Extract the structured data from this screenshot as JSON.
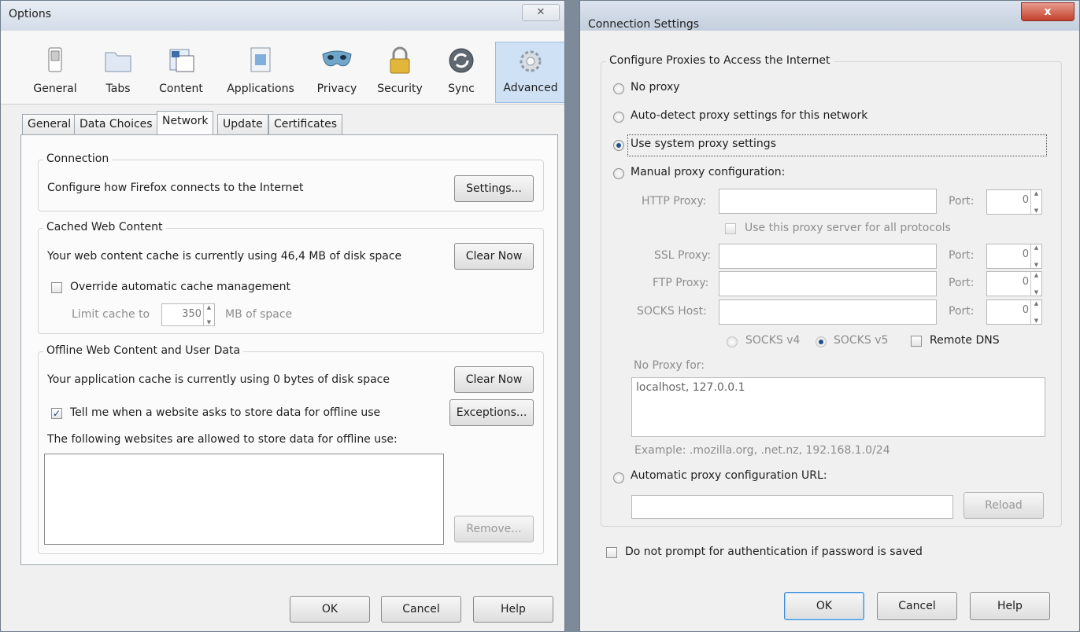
{
  "options": {
    "title": "Options",
    "categories": [
      {
        "label": "General",
        "icon": "general-switch-icon"
      },
      {
        "label": "Tabs",
        "icon": "tabs-folder-icon"
      },
      {
        "label": "Content",
        "icon": "content-icon"
      },
      {
        "label": "Applications",
        "icon": "applications-icon"
      },
      {
        "label": "Privacy",
        "icon": "privacy-mask-icon"
      },
      {
        "label": "Security",
        "icon": "security-lock-icon"
      },
      {
        "label": "Sync",
        "icon": "sync-icon"
      },
      {
        "label": "Advanced",
        "icon": "advanced-gear-icon"
      }
    ],
    "subtabs": [
      "General",
      "Data Choices",
      "Network",
      "Update",
      "Certificates"
    ],
    "connection": {
      "group_label": "Connection",
      "desc": "Configure how Firefox connects to the Internet",
      "settings_button": "Settings..."
    },
    "cache": {
      "group_label": "Cached Web Content",
      "desc": "Your web content cache is currently using 46,4 MB of disk space",
      "clear_button": "Clear Now",
      "override_label": "Override automatic cache management",
      "limit_prefix": "Limit cache to",
      "limit_value": "350",
      "limit_suffix": "MB of space"
    },
    "offline": {
      "group_label": "Offline Web Content and User Data",
      "desc": "Your application cache is currently using 0 bytes of disk space",
      "clear_button": "Clear Now",
      "tell_label": "Tell me when a website asks to store data for offline use",
      "exceptions_button": "Exceptions...",
      "allowed_label": "The following websites are allowed to store data for offline use:",
      "remove_button": "Remove..."
    },
    "buttons": {
      "ok": "OK",
      "cancel": "Cancel",
      "help": "Help"
    }
  },
  "connection_settings": {
    "title": "Connection Settings",
    "close_glyph": "x",
    "group_label": "Configure Proxies to Access the Internet",
    "no_proxy": "No proxy",
    "auto_detect": "Auto-detect proxy settings for this network",
    "use_system": "Use system proxy settings",
    "manual": "Manual proxy configuration:",
    "http_label": "HTTP Proxy:",
    "port_label": "Port:",
    "use_all": "Use this proxy server for all protocols",
    "ssl_label": "SSL Proxy:",
    "ftp_label": "FTP Proxy:",
    "socks_label": "SOCKS Host:",
    "port_value": "0",
    "socks_v4": "SOCKS v4",
    "socks_v5": "SOCKS v5",
    "remote_dns": "Remote DNS",
    "no_proxy_for": "No Proxy for:",
    "no_proxy_value": "localhost, 127.0.0.1",
    "example": "Example: .mozilla.org, .net.nz, 192.168.1.0/24",
    "auto_url": "Automatic proxy configuration URL:",
    "reload": "Reload",
    "no_prompt": "Do not prompt for authentication if password is saved",
    "buttons": {
      "ok": "OK",
      "cancel": "Cancel",
      "help": "Help"
    }
  }
}
